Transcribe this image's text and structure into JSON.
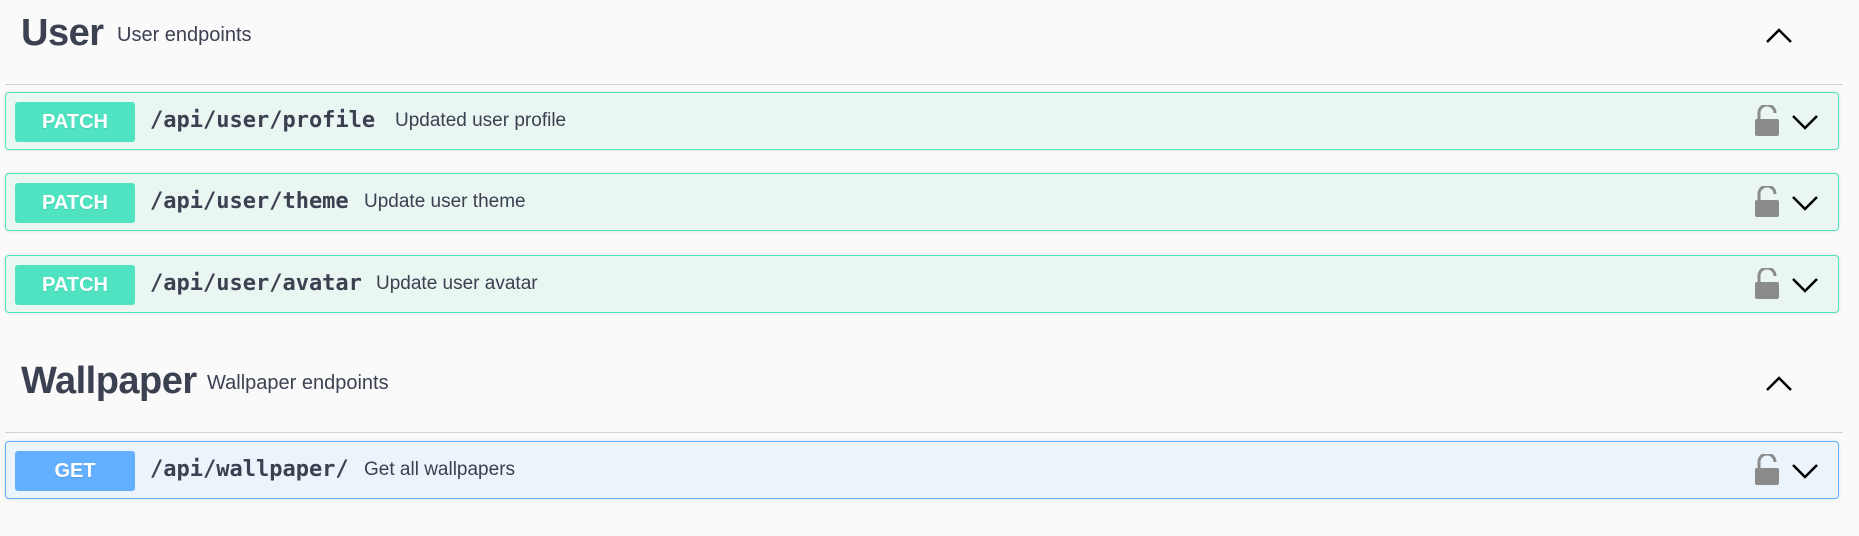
{
  "sections": [
    {
      "name": "User",
      "description": "User endpoints",
      "operations": [
        {
          "method": "PATCH",
          "path": "/api/user/profile",
          "summary": "Updated user profile"
        },
        {
          "method": "PATCH",
          "path": "/api/user/theme",
          "summary": "Update user theme"
        },
        {
          "method": "PATCH",
          "path": "/api/user/avatar",
          "summary": "Update user avatar"
        }
      ]
    },
    {
      "name": "Wallpaper",
      "description": "Wallpaper endpoints",
      "operations": [
        {
          "method": "GET",
          "path": "/api/wallpaper/",
          "summary": "Get all wallpapers"
        }
      ]
    }
  ],
  "colors": {
    "patch": "#50e3c2",
    "get": "#61affe",
    "text": "#3b4151"
  },
  "icons": {
    "collapse": "chevron-up-icon",
    "expand": "chevron-down-icon",
    "auth": "lock-open-icon"
  }
}
